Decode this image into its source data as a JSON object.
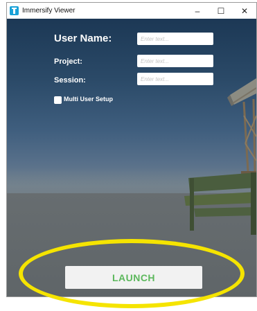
{
  "window": {
    "title": "Immersify Viewer",
    "controls": {
      "minimize": "–",
      "maximize": "☐",
      "close": "✕"
    }
  },
  "form": {
    "user_name": {
      "label": "User Name:",
      "placeholder": "Enter text..."
    },
    "project": {
      "label": "Project:",
      "placeholder": "Enter text..."
    },
    "session": {
      "label": "Session:",
      "placeholder": "Enter text..."
    },
    "multi_user": {
      "label": "Multi User Setup",
      "checked": false
    }
  },
  "launch": {
    "label": "LAUNCH"
  },
  "colors": {
    "highlight": "#f5e400",
    "launch_text": "#5cb85c",
    "app_icon": "#1aa2d8"
  },
  "icons": {
    "app": "immersify-app-icon",
    "minimize": "minimize-icon",
    "maximize": "maximize-icon",
    "close": "close-icon"
  }
}
